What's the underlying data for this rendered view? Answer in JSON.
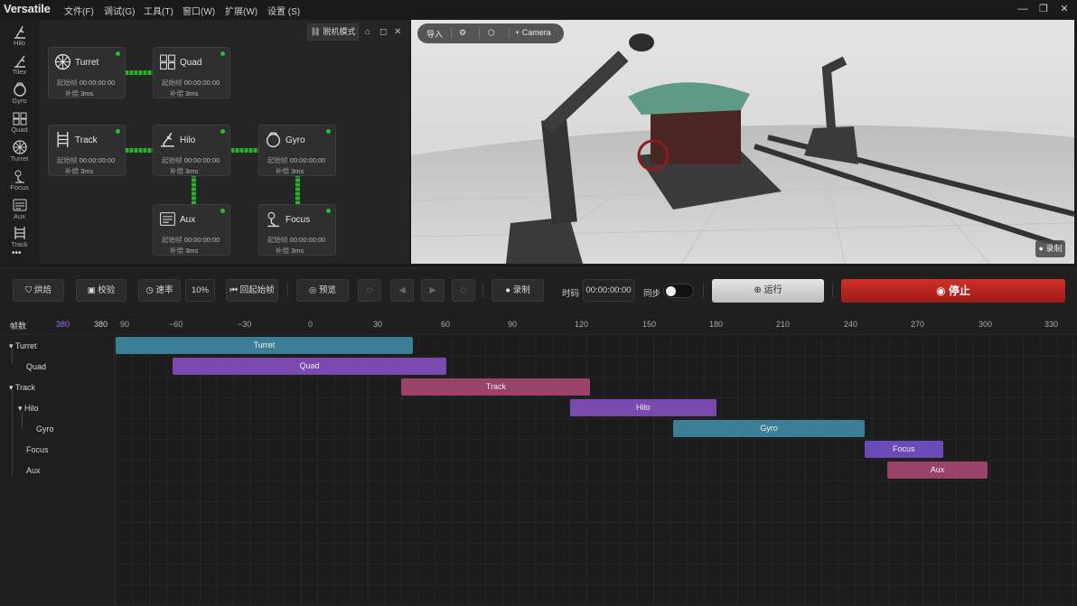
{
  "app": {
    "logo": "Versatile"
  },
  "menu": [
    "文件(F)",
    "调试(G)",
    "工具(T)",
    "窗口(W)",
    "扩展(W)",
    "设置 (S)"
  ],
  "window_controls": [
    "—",
    "❐",
    "✕"
  ],
  "toolrail": [
    "Hilo",
    "Tilex",
    "Gyro",
    "Quad",
    "Turret",
    "Focus",
    "Aux",
    "Track"
  ],
  "toolrail_more": "•••",
  "graph": {
    "offline_label": "脱机模式",
    "nodes": [
      {
        "name": "Turret",
        "start_label": "起始帧",
        "start": "00:00:00:00",
        "comp_label": "补偿",
        "comp": "3ms",
        "icon": "turret-icon"
      },
      {
        "name": "Quad",
        "start_label": "起始帧",
        "start": "00:00:00:00",
        "comp_label": "补偿",
        "comp": "3ms",
        "icon": "quad-icon"
      },
      {
        "name": "Track",
        "start_label": "起始帧",
        "start": "00:00:00:00",
        "comp_label": "补偿",
        "comp": "3ms",
        "icon": "track-icon"
      },
      {
        "name": "Hilo",
        "start_label": "起始帧",
        "start": "00:00:00:00",
        "comp_label": "补偿",
        "comp": "3ms",
        "icon": "hilo-icon"
      },
      {
        "name": "Gyro",
        "start_label": "起始帧",
        "start": "00:00:00:00",
        "comp_label": "补偿",
        "comp": "3ms",
        "icon": "gyro-icon"
      },
      {
        "name": "Aux",
        "start_label": "起始帧",
        "start": "00:00:00:00",
        "comp_label": "补偿",
        "comp": "3ms",
        "icon": "aux-icon"
      },
      {
        "name": "Focus",
        "start_label": "起始帧",
        "start": "00:00:00:00",
        "comp_label": "补偿",
        "comp": "3ms",
        "icon": "focus-icon"
      }
    ]
  },
  "viewport": {
    "import_label": "导入",
    "camera_label": "Camera",
    "record_badge": "录制"
  },
  "toolbar": {
    "bake": "烘焙",
    "calibrate": "校验",
    "speed": "速率",
    "speed_value": "10%",
    "back_to_start": "回起始帧",
    "preview": "预览",
    "record": "录制",
    "timecode_label": "时码",
    "timecode": "00:00:00:00",
    "sync_label": "同步",
    "sync_on": true,
    "run": "运行",
    "stop": "停止"
  },
  "timeline": {
    "frames_label": "帧数",
    "frames_value_accent": "380",
    "frames_value": "380",
    "accent_color": "#9b6cf0",
    "ticks": [
      "90",
      "−60",
      "−30",
      "0",
      "30",
      "60",
      "90",
      "120",
      "150",
      "180",
      "210",
      "240",
      "270",
      "300",
      "330"
    ],
    "tree": [
      "Turret",
      "Quad",
      "Track",
      "Hilo",
      "Gyro",
      "Focus",
      "Aux"
    ],
    "tracks": [
      {
        "name": "Turret",
        "start": -90,
        "end": 45,
        "color": "#3a7f96"
      },
      {
        "name": "Quad",
        "start": -62,
        "end": 60,
        "color": "#7a4ab0"
      },
      {
        "name": "Track",
        "start": 40,
        "end": 124,
        "color": "#9a4268"
      },
      {
        "name": "Hilo",
        "start": 115,
        "end": 180,
        "color": "#7a4ab0"
      },
      {
        "name": "Gyro",
        "start": 161,
        "end": 246,
        "color": "#3a7f96"
      },
      {
        "name": "Focus",
        "start": 246,
        "end": 281,
        "color": "#6a4ab8"
      },
      {
        "name": "Aux",
        "start": 256,
        "end": 301,
        "color": "#9a4268"
      }
    ]
  }
}
